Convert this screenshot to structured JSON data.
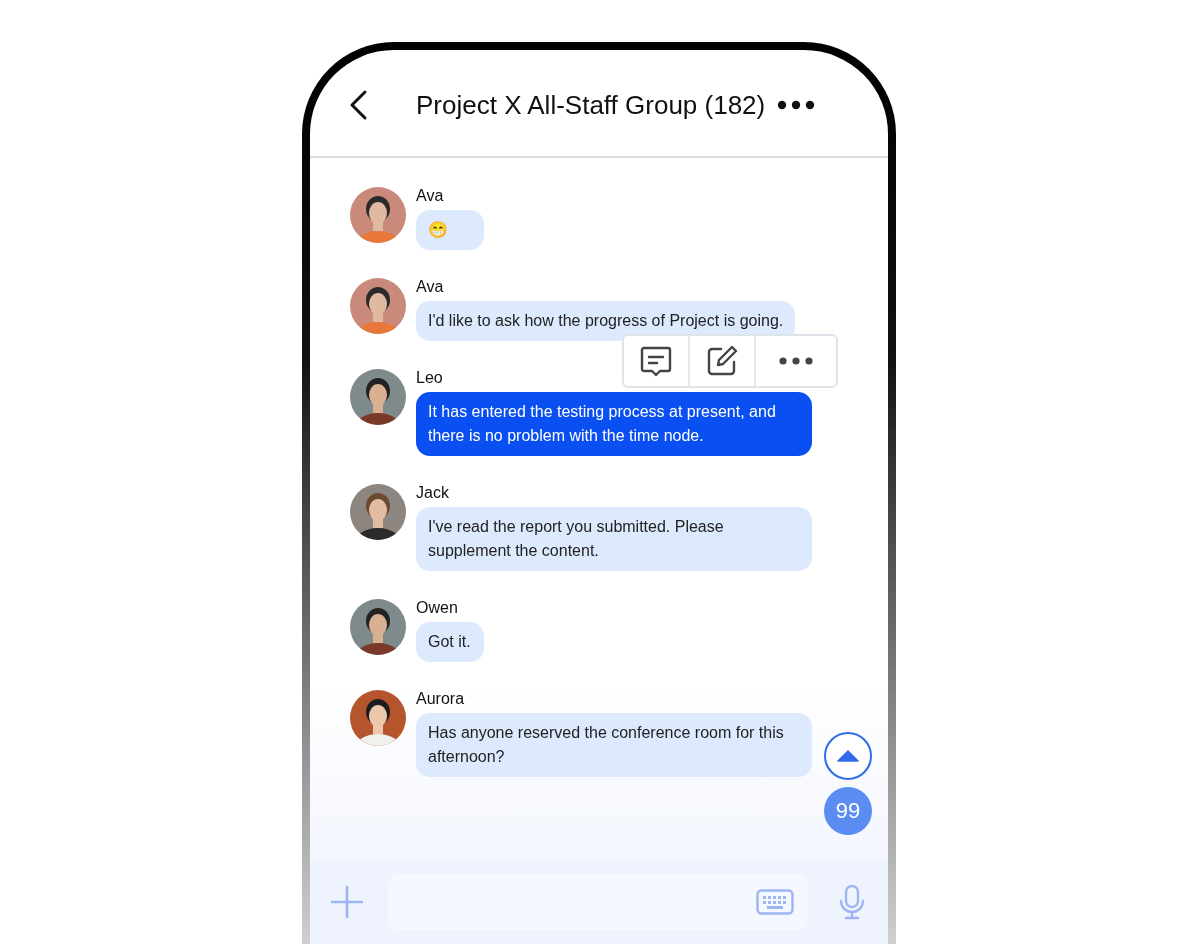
{
  "header": {
    "title": "Project X All-Staff Group (182)"
  },
  "messages": [
    {
      "sender": "Ava",
      "text": "😁",
      "selected": false
    },
    {
      "sender": "Ava",
      "text": "I'd like to ask how the progress of Project is going.",
      "selected": false
    },
    {
      "sender": "Leo",
      "text": "It has entered the testing process at present, and there is no problem with the time node.",
      "selected": true
    },
    {
      "sender": "Jack",
      "text": "I've read the report you submitted. Please supplement the content.",
      "selected": false
    },
    {
      "sender": "Owen",
      "text": "Got it.",
      "selected": false
    },
    {
      "sender": "Aurora",
      "text": "Has anyone reserved the conference room for this afternoon?",
      "selected": false
    }
  ],
  "unread_badge": {
    "count": "99"
  }
}
